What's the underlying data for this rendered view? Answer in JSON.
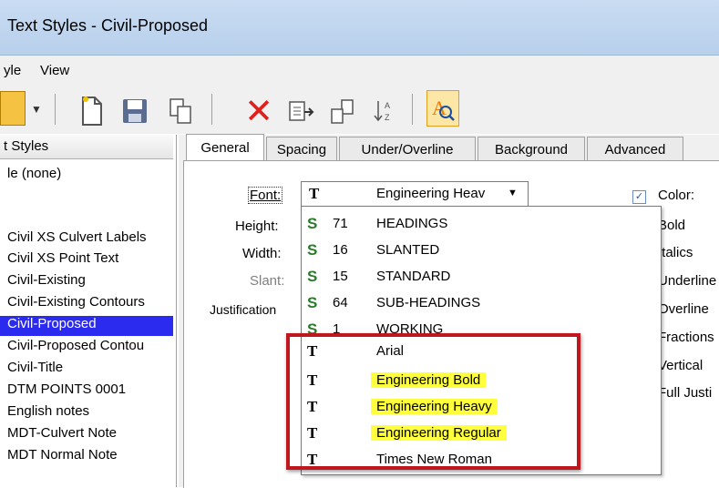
{
  "window": {
    "title": "Text Styles - Civil-Proposed"
  },
  "menu": {
    "items": [
      "yle",
      "View"
    ]
  },
  "list": {
    "header": "t Styles",
    "items": [
      "le (none)",
      "Civil XS Culvert Labels",
      "Civil XS Point Text",
      "Civil-Existing",
      "Civil-Existing Contours",
      "Civil-Proposed",
      "Civil-Proposed Contou",
      "Civil-Title",
      "DTM POINTS 0001",
      "English notes",
      "MDT-Culvert Note",
      "MDT Normal Note"
    ],
    "selected_index": 5
  },
  "tabs": [
    "General",
    "Spacing",
    "Under/Overline",
    "Background",
    "Advanced"
  ],
  "general": {
    "font_label": "Font:",
    "height_label": "Height:",
    "width_label": "Width:",
    "slant_label": "Slant:",
    "justification_label": "Justification",
    "font_value": "Engineering Heav",
    "color_label": "Color:",
    "right_options": [
      "Bold",
      "Italics",
      "Underline",
      "Overline",
      "Fractions",
      "Vertical",
      "Full Justi"
    ]
  },
  "font_list": [
    {
      "icon": "rsc-font-icon",
      "num": "71",
      "name": "HEADINGS"
    },
    {
      "icon": "rsc-font-icon",
      "num": "16",
      "name": "SLANTED"
    },
    {
      "icon": "rsc-font-icon",
      "num": "15",
      "name": "STANDARD"
    },
    {
      "icon": "rsc-font-icon",
      "num": "64",
      "name": "SUB-HEADINGS"
    },
    {
      "icon": "rsc-font-icon",
      "num": "1",
      "name": "WORKING"
    },
    {
      "icon": "truetype-font-icon",
      "num": "",
      "name": "Arial"
    },
    {
      "icon": "truetype-font-icon",
      "num": "",
      "name": "Engineering Bold"
    },
    {
      "icon": "truetype-font-icon",
      "num": "",
      "name": "Engineering Heavy"
    },
    {
      "icon": "truetype-font-icon",
      "num": "",
      "name": "Engineering Regular"
    },
    {
      "icon": "truetype-font-icon",
      "num": "",
      "name": "Times New Roman"
    }
  ],
  "colors": {
    "highlight": "#ffff3b",
    "selection": "#2b2bf0",
    "annotation_box": "#c0171e"
  }
}
